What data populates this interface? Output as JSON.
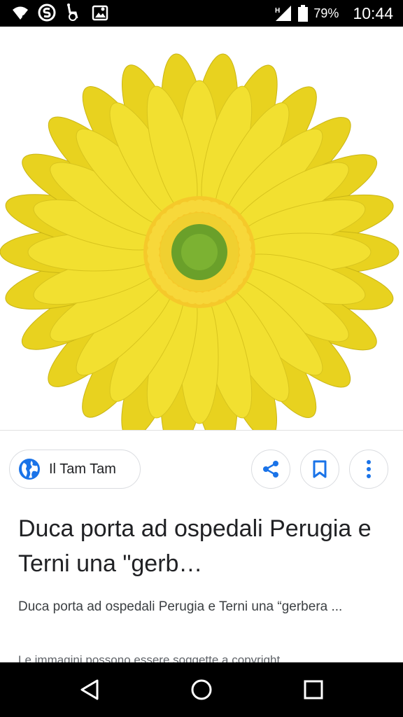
{
  "status_bar": {
    "icons": [
      "wifi-question-icon",
      "swiftkey-icon",
      "accessibility-icon",
      "gallery-icon",
      "network-h-plus-icon",
      "battery-icon"
    ],
    "battery_percent": "79%",
    "time": "10:44"
  },
  "image": {
    "subject": "yellow-gerbera-flower",
    "petal_color": "#f2e030",
    "center_color": "#6aa02a",
    "ring_color": "#f5c92a"
  },
  "source": {
    "icon": "globe-icon",
    "name": "Il Tam Tam"
  },
  "actions": {
    "share_icon": "share-icon",
    "save_icon": "bookmark-icon",
    "more_icon": "more-vert-icon",
    "accent": "#1a73e8"
  },
  "result": {
    "title": "Duca porta ad ospedali Perugia e Terni una \"gerb…",
    "snippet": "Duca porta ad ospedali Perugia e Terni una “gerbera ...",
    "copyright": "Le immagini possono essere soggette a copyright."
  },
  "nav_bar": {
    "back_icon": "back-triangle-icon",
    "home_icon": "home-circle-icon",
    "recent_icon": "recents-square-icon"
  }
}
